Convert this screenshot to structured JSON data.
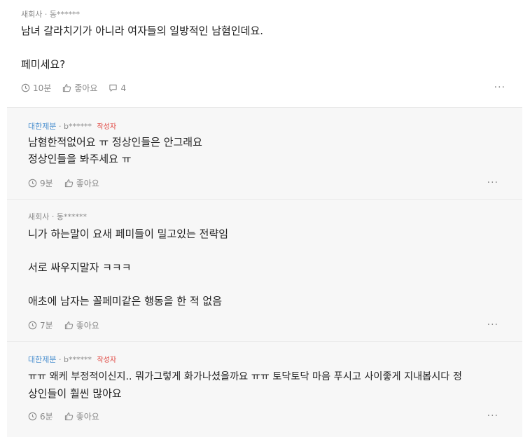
{
  "comment": {
    "company": "새회사",
    "author": "동******",
    "lines": [
      "남녀 갈라치기가 아니라 여자들의 일방적인 남혐인데요.",
      "",
      "페미세요?"
    ],
    "time": "10분",
    "like": "좋아요",
    "reply_count": "4"
  },
  "replies": [
    {
      "company": "대한제분",
      "author": "b******",
      "author_tag": "작성자",
      "lines": [
        "남혐한적없어요 ㅠ 정상인들은 안그래요",
        "정상인들을 봐주세요 ㅠ"
      ],
      "time": "9분",
      "like": "좋아요"
    },
    {
      "company": "새회사",
      "author": "동******",
      "lines": [
        "니가 하는말이 요새 페미들이 밀고있는 전략임",
        "",
        "서로 싸우지말자 ㅋㅋㅋ",
        "",
        "애초에 남자는 꼴페미같은 행동을 한 적 없음"
      ],
      "time": "7분",
      "like": "좋아요"
    },
    {
      "company": "대한제분",
      "author": "b******",
      "author_tag": "작성자",
      "lines": [
        "ㅠㅠ 왜케 부정적이신지.. 뭐가그렇게 화가나셨을까요 ㅠㅠ 토닥토닥 마음 푸시고 사이좋게 지내봅시다 정",
        "상인들이 훨씬 많아요"
      ],
      "time": "6분",
      "like": "좋아요"
    }
  ],
  "more_label": "···",
  "colors": {
    "company_blue": "#4a8fcf",
    "author_tag_red": "#e0443e",
    "reply_bg": "#f7f7f7"
  },
  "icons": {
    "time": "clock-icon",
    "like": "thumbs-up-icon",
    "reply": "speech-bubble-icon",
    "more": "more-dots-icon"
  }
}
